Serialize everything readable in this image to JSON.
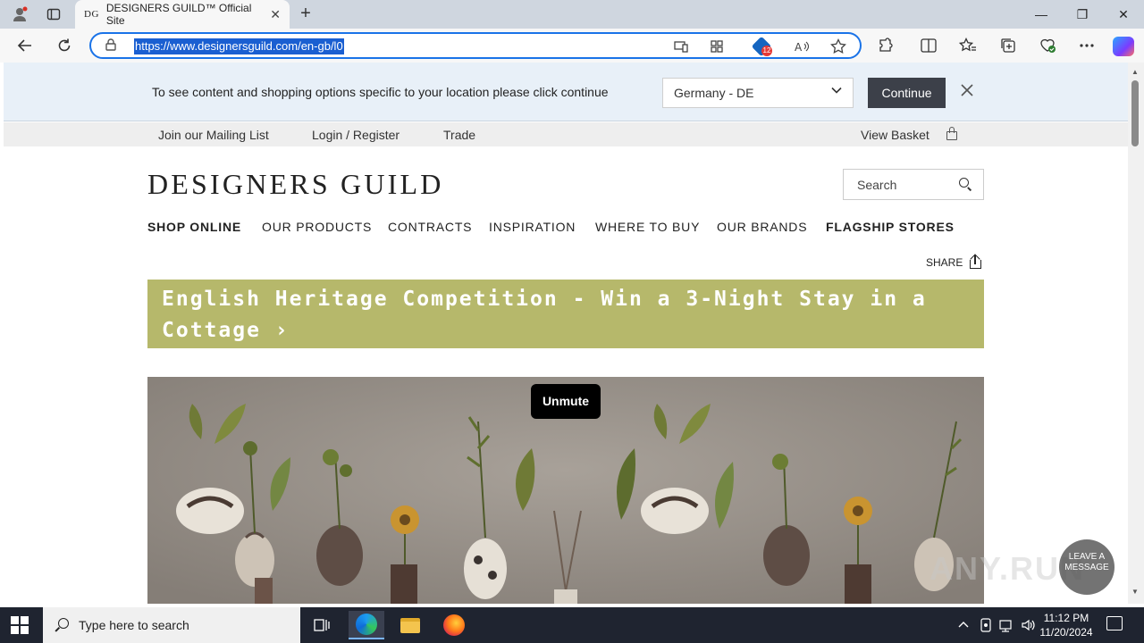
{
  "browser": {
    "tab": {
      "favicon_text": "DG",
      "title": "DESIGNERS GUILD™ Official Site",
      "close": "✕"
    },
    "new_tab": "+",
    "window_controls": {
      "minimize": "—",
      "maximize": "❐",
      "close": "✕"
    },
    "url": "https://www.designersguild.com/en-gb/l0",
    "extension_badge": "12",
    "icons": [
      "back-arrow-icon",
      "refresh-icon",
      "lock-icon",
      "device-icon",
      "apps-icon",
      "read-aloud-icon",
      "favorite-star-icon",
      "extensions-icon",
      "split-screen-icon",
      "favorites-icon",
      "collections-icon",
      "performance-icon",
      "more-icon",
      "copilot-icon"
    ]
  },
  "location_banner": {
    "message": "To see content and shopping options specific to your location please click continue",
    "selected_country": "Germany - DE",
    "continue_label": "Continue"
  },
  "utility_nav": {
    "mailing_list": "Join our Mailing List",
    "login": "Login / Register",
    "trade": "Trade",
    "basket": "View Basket"
  },
  "header": {
    "logo": "DESIGNERS GUILD",
    "search_placeholder": "Search"
  },
  "main_nav": [
    "SHOP ONLINE",
    "OUR PRODUCTS",
    "CONTRACTS",
    "INSPIRATION",
    "WHERE TO BUY",
    "OUR BRANDS",
    "FLAGSHIP STORES"
  ],
  "share_label": "SHARE",
  "promo": {
    "text": "English Heritage Competition - Win a 3-Night Stay in a Cottage ›",
    "background": "#b6b86b"
  },
  "hero": {
    "unmute_label": "Unmute"
  },
  "chat_widget": {
    "label": "LEAVE A MESSAGE"
  },
  "watermark": "ANY.RUN",
  "taskbar": {
    "search_placeholder": "Type here to search",
    "time": "11:12 PM",
    "date": "11/20/2024"
  }
}
